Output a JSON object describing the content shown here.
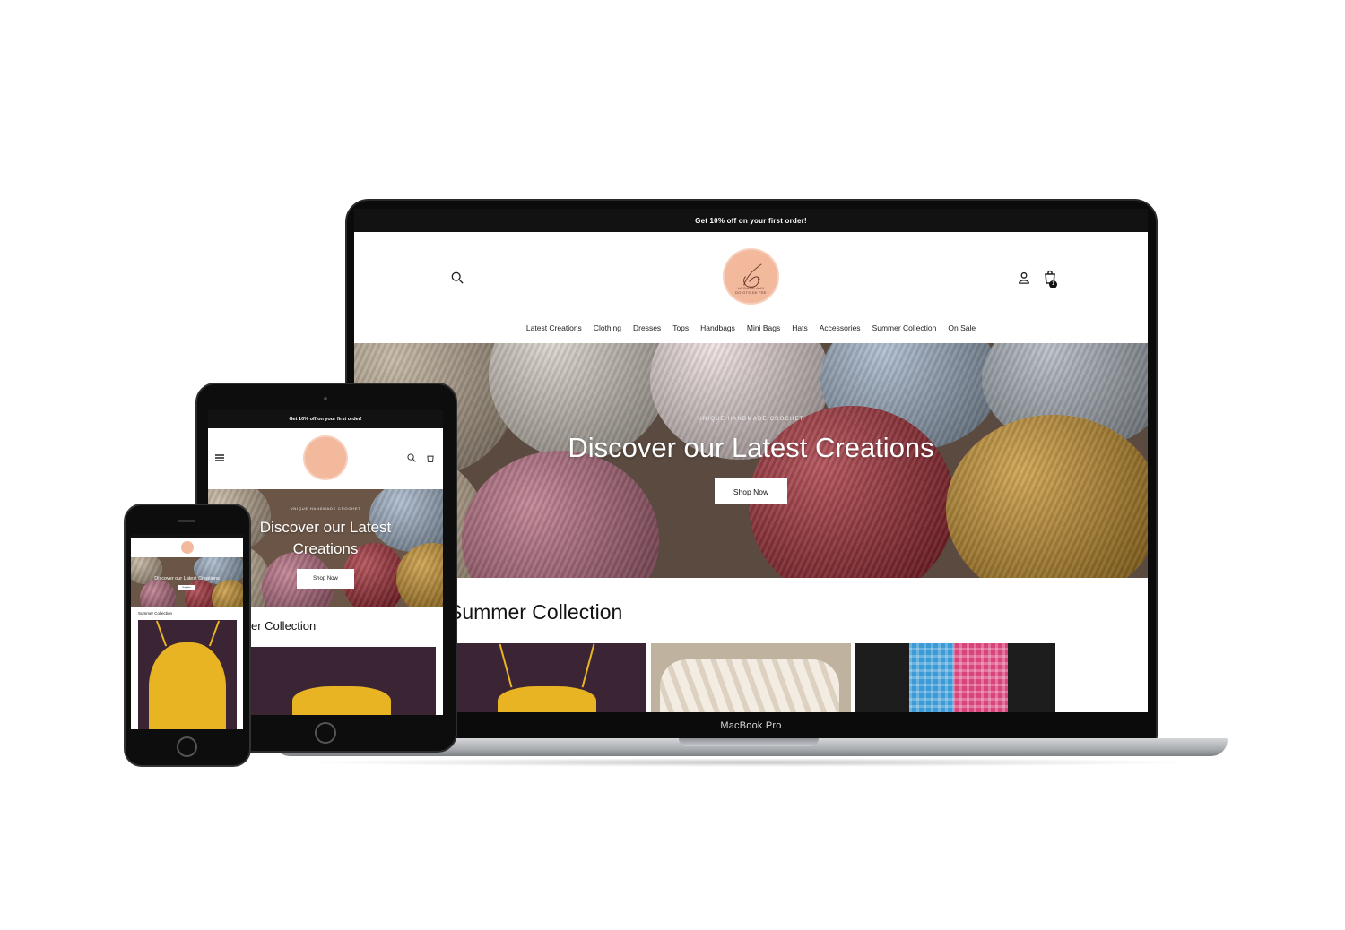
{
  "site": {
    "announcement": "Get 10% off on your first order!",
    "brand_logo_text": "LA DAME AUX DOIGTS DE FÉE",
    "cart_count": "1",
    "nav": [
      "Latest Creations",
      "Clothing",
      "Dresses",
      "Tops",
      "Handbags",
      "Mini Bags",
      "Hats",
      "Accessories",
      "Summer Collection",
      "On Sale"
    ],
    "hero": {
      "eyebrow": "UNIQUE HANDMADE CROCHET",
      "title": "Discover our Latest Creations",
      "button": "Shop Now"
    },
    "section_title": "Summer Collection",
    "tablet_section_title_partial": "er Collection",
    "phone_section_title": "Summer Collection"
  },
  "device": {
    "laptop_label": "MacBook Pro"
  },
  "colors": {
    "announcement_bg": "#121212",
    "logo_peach": "#f2b99d",
    "button_bg": "#ffffff"
  },
  "icons": [
    "search-icon",
    "user-icon",
    "cart-icon",
    "menu-icon"
  ]
}
